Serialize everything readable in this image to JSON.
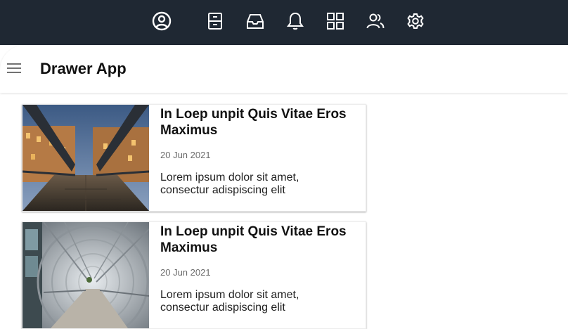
{
  "topbar": {
    "icons": [
      "account-circle-icon",
      "archive-icon",
      "inbox-icon",
      "bell-icon",
      "grid-icon",
      "users-icon",
      "gear-icon"
    ],
    "background": "#1f2833",
    "icon_color": "#ffffff"
  },
  "appbar": {
    "title": "Drawer App"
  },
  "cards": [
    {
      "title": "In Loep unpit Quis Vitae Eros Maximus",
      "date": "20 Jun 2021",
      "text": "Lorem ipsum dolor sit amet, consectur adispiscing elit"
    },
    {
      "title": "In Loep unpit Quis Vitae Eros Maximus",
      "date": "20 Jun 2021",
      "text": "Lorem ipsum dolor sit amet, consectur adispiscing elit"
    }
  ]
}
